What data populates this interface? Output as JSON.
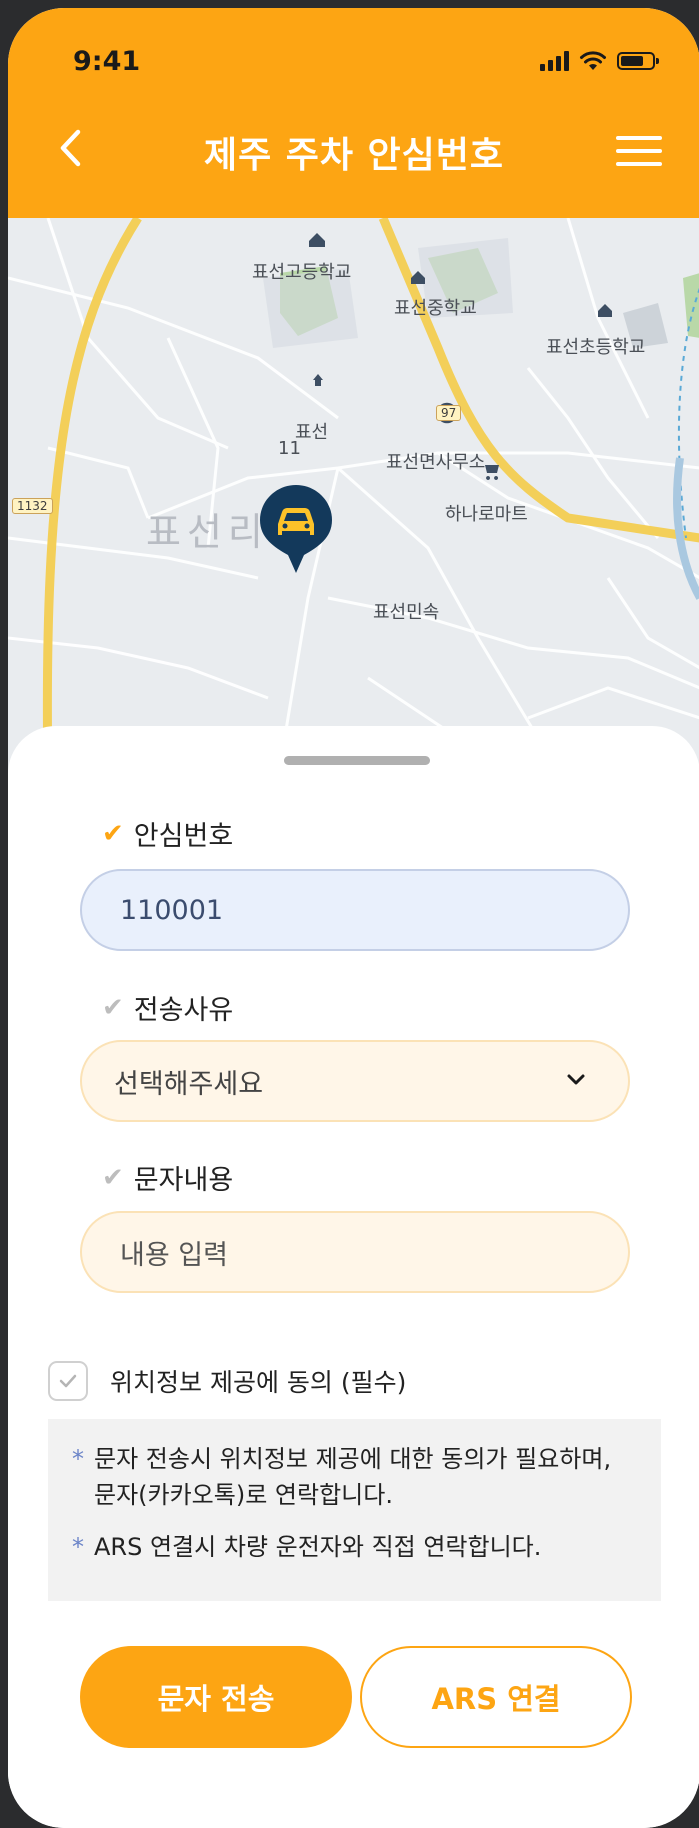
{
  "status": {
    "time": "9:41"
  },
  "header": {
    "title": "제주 주차 안심번호",
    "back_icon": "chevron-left-icon",
    "menu_icon": "hamburger-menu-icon"
  },
  "map": {
    "labels": [
      "표선고등학교",
      "표선중학교",
      "표선초등학교",
      "표선면사무소",
      "하나로마트",
      "표선민속",
      "표선",
      "11"
    ],
    "area": "표선리",
    "route_signs": [
      "97",
      "1132"
    ],
    "pin_icon": "car-location-pin-icon"
  },
  "form": {
    "fields": [
      {
        "label": "안심번호",
        "value": "110001",
        "active": true
      },
      {
        "label": "전송사유",
        "value": "선택해주세요",
        "active": false
      },
      {
        "label": "문자내용",
        "placeholder": "내용 입력",
        "active": false
      }
    ],
    "agree_label": "위치정보 제공에 동의 (필수)",
    "notices": [
      "문자 전송시 위치정보 제공에 대한 동의가 필요하며, 문자(카카오톡)로 연락합니다.",
      "ARS 연결시 차량 운전자와 직접 연락합니다."
    ],
    "buttons": {
      "primary": "문자 전송",
      "secondary": "ARS 연결"
    }
  },
  "colors": {
    "accent": "#fda513",
    "pin": "#13395b"
  }
}
